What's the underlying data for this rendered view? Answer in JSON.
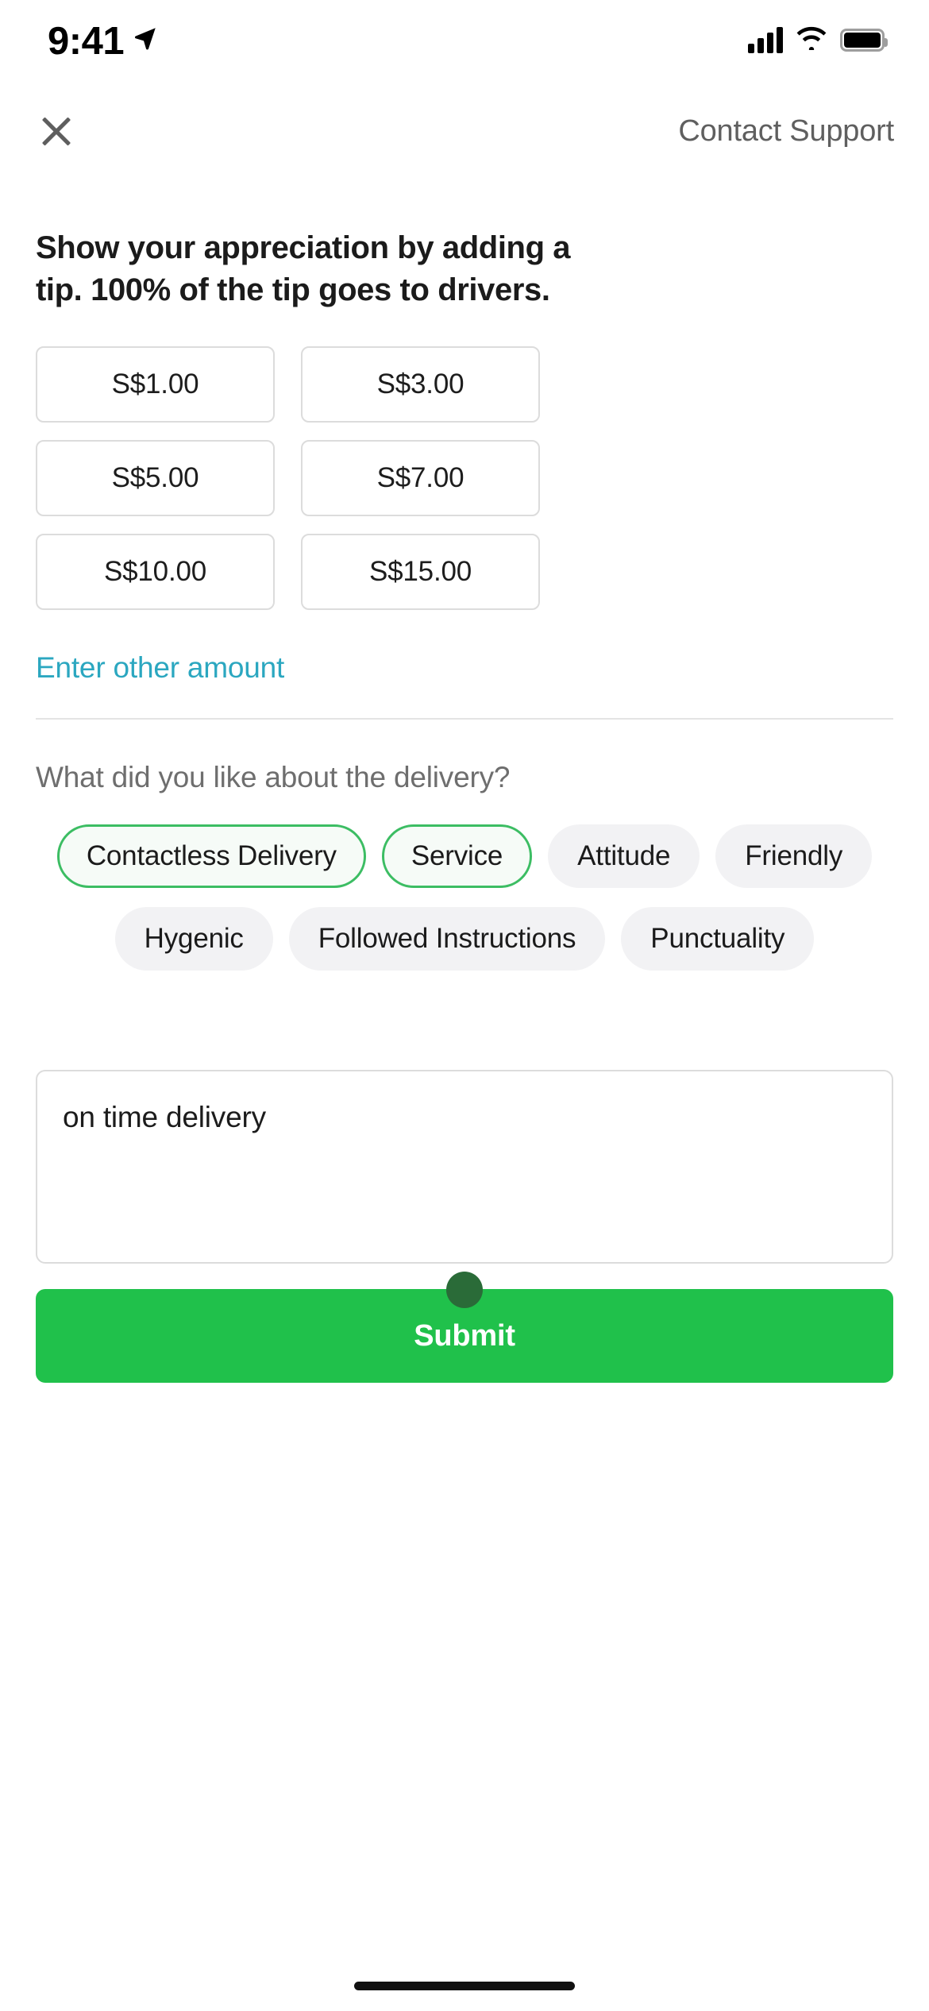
{
  "status_bar": {
    "time": "9:41",
    "location_icon": "location-arrow-icon",
    "signal_icon": "cellular-signal-icon",
    "wifi_icon": "wifi-icon",
    "battery_icon": "battery-full-icon"
  },
  "header": {
    "close_icon": "close-icon",
    "contact_support_label": "Contact Support"
  },
  "tip": {
    "heading": "Show your appreciation by adding a tip. 100% of the tip goes to drivers.",
    "options": [
      {
        "label": "S$1.00",
        "selected": false
      },
      {
        "label": "S$3.00",
        "selected": false
      },
      {
        "label": "S$5.00",
        "selected": false
      },
      {
        "label": "S$7.00",
        "selected": false
      },
      {
        "label": "S$10.00",
        "selected": false
      },
      {
        "label": "S$15.00",
        "selected": false
      }
    ],
    "other_amount_label": "Enter other amount",
    "other_amount_color": "#2ba7c0"
  },
  "feedback": {
    "question": "What did you like about the delivery?",
    "chips": [
      {
        "label": "Contactless Delivery",
        "selected": true
      },
      {
        "label": "Service",
        "selected": true
      },
      {
        "label": "Attitude",
        "selected": false
      },
      {
        "label": "Friendly",
        "selected": false
      },
      {
        "label": "Hygenic",
        "selected": false
      },
      {
        "label": "Followed Instructions",
        "selected": false
      },
      {
        "label": "Punctuality",
        "selected": false
      }
    ],
    "selected_chip_color": "#3cbd63",
    "unselected_chip_bg": "#f2f2f4"
  },
  "comment": {
    "value": "on time delivery",
    "placeholder": ""
  },
  "submit": {
    "label": "Submit",
    "color": "#20c14b"
  },
  "home_indicator": "home-indicator"
}
